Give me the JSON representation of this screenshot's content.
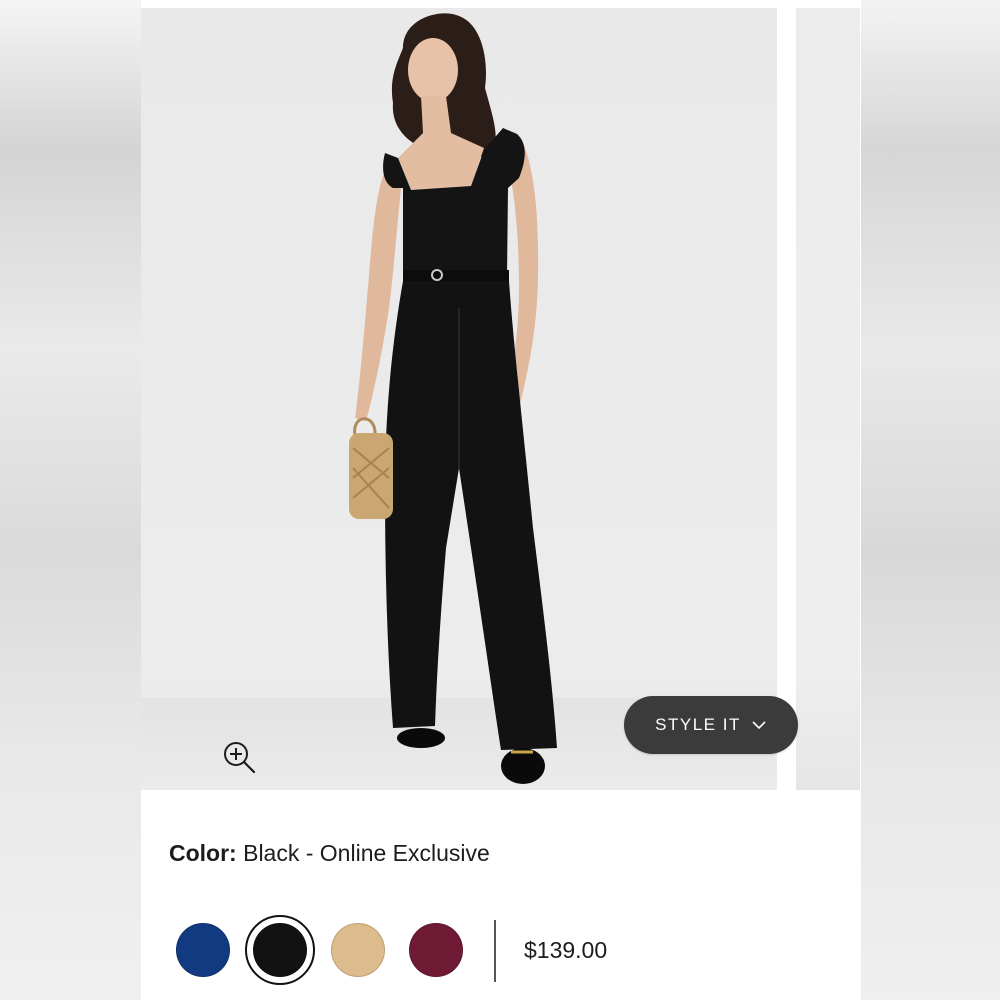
{
  "product": {
    "image_alt": "Model wearing black square neck belted jumpsuit",
    "style_it_label": "STYLE IT",
    "color_label": "Color:",
    "color_value": "Black - Online Exclusive",
    "price": "$139.00"
  },
  "swatches": [
    {
      "name": "navy",
      "color": "#123a80",
      "selected": false
    },
    {
      "name": "black",
      "color": "#121212",
      "selected": true
    },
    {
      "name": "tan",
      "color": "#dcbc8c",
      "selected": false
    },
    {
      "name": "wine",
      "color": "#6e1a34",
      "selected": false
    }
  ],
  "icons": {
    "zoom": "zoom-in-icon",
    "style_it_chevron": "chevron-down-icon"
  }
}
